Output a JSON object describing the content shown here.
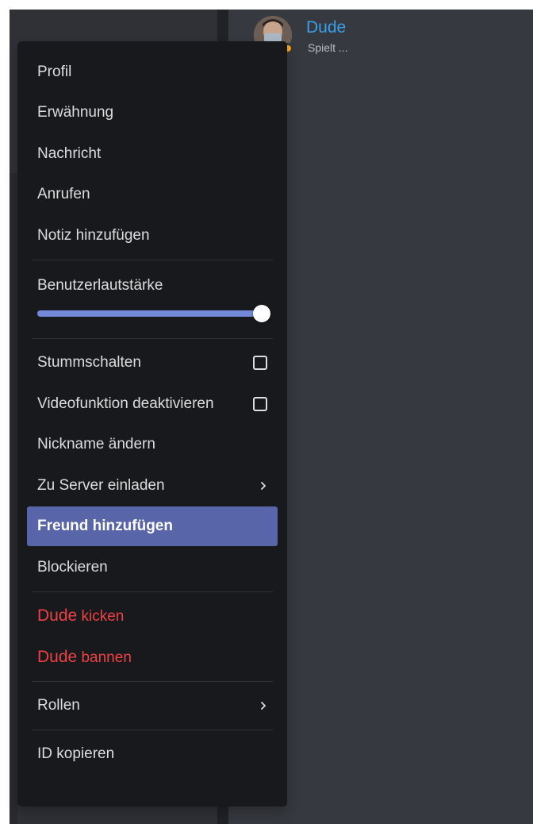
{
  "member": {
    "name": "Dude",
    "status_text": "Spielt ...",
    "status_color": "#faa61a"
  },
  "menu": {
    "profile": "Profil",
    "mention": "Erwähnung",
    "message": "Nachricht",
    "call": "Anrufen",
    "add_note": "Notiz hinzufügen",
    "user_volume": "Benutzerlautstärke",
    "user_volume_level": 1.0,
    "mute": "Stummschalten",
    "disable_video": "Videofunktion deaktivieren",
    "change_nickname": "Nickname ändern",
    "invite_to_server": "Zu Server einladen",
    "add_friend": "Freund hinzufügen",
    "block": "Blockieren",
    "kick_name": "Dude",
    "kick_action": "kicken",
    "ban_name": "Dude",
    "ban_action": "bannen",
    "roles": "Rollen",
    "copy_id": "ID kopieren"
  },
  "colors": {
    "accent": "#5865a8",
    "danger": "#ed4245",
    "username": "#3ba0ea",
    "slider_fill": "#7289da"
  },
  "icons": {
    "checkbox": "checkbox-empty-icon",
    "submenu": "chevron-right-icon"
  }
}
